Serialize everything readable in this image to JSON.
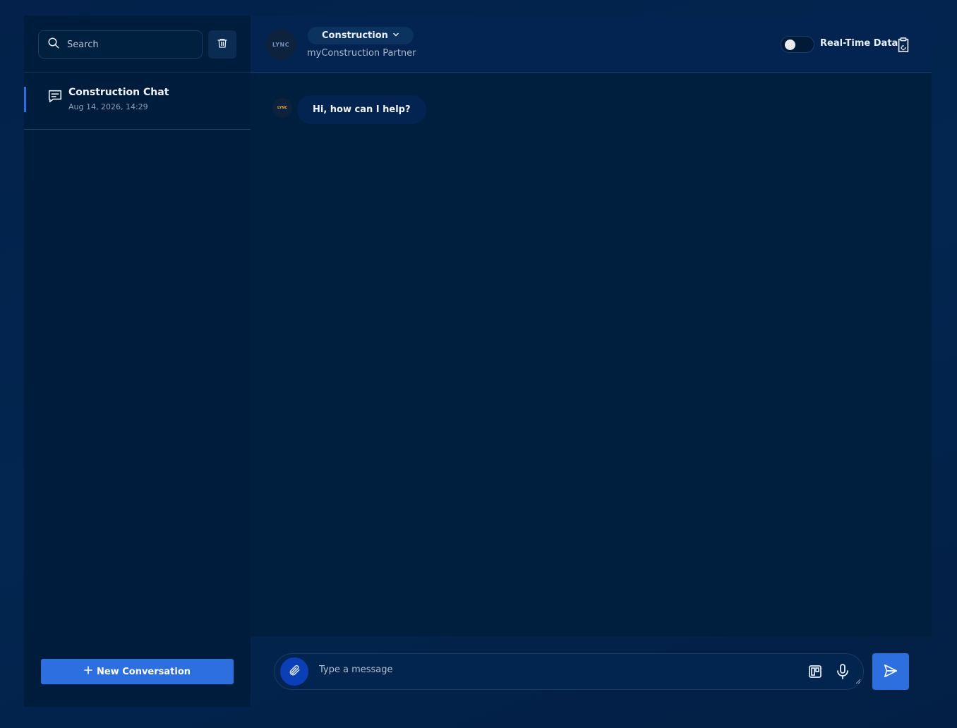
{
  "sidebar": {
    "search": {
      "placeholder": "Search"
    },
    "conversations": [
      {
        "title": "Construction Chat",
        "date": "Aug 14, 2026, 14:29"
      }
    ],
    "new_conversation_label": "New Conversation"
  },
  "header": {
    "logo_text": "LYNC",
    "industry": "Construction",
    "subtitle": "myConstruction Partner",
    "realtime_label": "Real-Time Data",
    "realtime_enabled": false
  },
  "chat": {
    "messages": [
      {
        "role": "assistant",
        "text": "Hi, how can I help?"
      }
    ]
  },
  "composer": {
    "placeholder": "Type a message"
  },
  "colors": {
    "accent": "#2e6fe0",
    "background": "#001e3e",
    "attach": "#0b3fb8",
    "logo": "#e8a24a"
  },
  "icons": [
    "search-icon",
    "trash-icon",
    "chat-icon",
    "plus-icon",
    "chevron-down-icon",
    "clipboard-icon",
    "paperclip-icon",
    "templates-icon",
    "mic-icon",
    "send-icon"
  ]
}
